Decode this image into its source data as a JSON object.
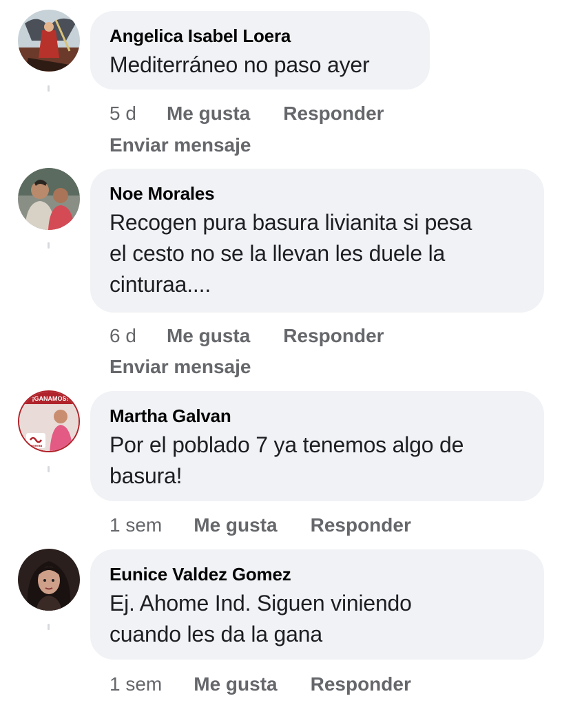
{
  "comments": [
    {
      "author": "Angelica Isabel Loera",
      "text_lines": [
        "Mediterráneo no paso ayer"
      ],
      "time": "5 d",
      "like": "Me gusta",
      "reply": "Responder",
      "message": "Enviar mensaje"
    },
    {
      "author": "Noe Morales",
      "text_lines": [
        "Recogen pura basura livianita si pesa",
        "el cesto no se la llevan les duele la",
        "cinturaa...."
      ],
      "time": "6 d",
      "like": "Me gusta",
      "reply": "Responder",
      "message": "Enviar mensaje"
    },
    {
      "author": "Martha Galvan",
      "avatar_badge_top": "¡GANAMOS!",
      "avatar_badge_bottom": "morena",
      "text_lines": [
        "Por el poblado 7 ya tenemos algo de",
        "basura!"
      ],
      "time": "1 sem",
      "like": "Me gusta",
      "reply": "Responder"
    },
    {
      "author": "Eunice Valdez Gomez",
      "text_lines": [
        "Ej. Ahome Ind. Siguen viniendo",
        "cuando les da la gana"
      ],
      "time": "1 sem",
      "like": "Me gusta",
      "reply": "Responder"
    }
  ],
  "colors": {
    "bubble": "#f0f2f5",
    "meta": "#65676b",
    "author": "#050505"
  },
  "icons": [
    "avatar-angelica",
    "avatar-noe",
    "avatar-martha",
    "avatar-eunice"
  ]
}
